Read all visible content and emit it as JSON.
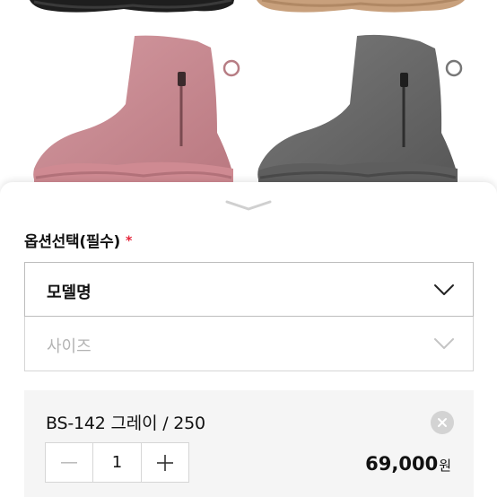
{
  "product_images": {
    "boots": [
      {
        "name": "pink-boot",
        "color": "#c98c93"
      },
      {
        "name": "gray-boot",
        "color": "#6b6b6b"
      }
    ],
    "top_boots": [
      {
        "name": "black-boot",
        "color": "#222222"
      },
      {
        "name": "tan-boot",
        "color": "#c49a78"
      }
    ]
  },
  "sheet": {
    "title": "옵션선택(필수)",
    "required_mark": "*",
    "select_model": {
      "label": "모델명",
      "icon": "chevron-down-icon"
    },
    "select_size": {
      "label": "사이즈",
      "icon": "chevron-down-icon"
    },
    "selected_item": {
      "title": "BS-142 그레이 / 250",
      "quantity": "1",
      "price": "69,000",
      "price_unit": "원"
    }
  },
  "colors": {
    "required": "#e5253a",
    "item_bg": "#f5f5f5"
  }
}
